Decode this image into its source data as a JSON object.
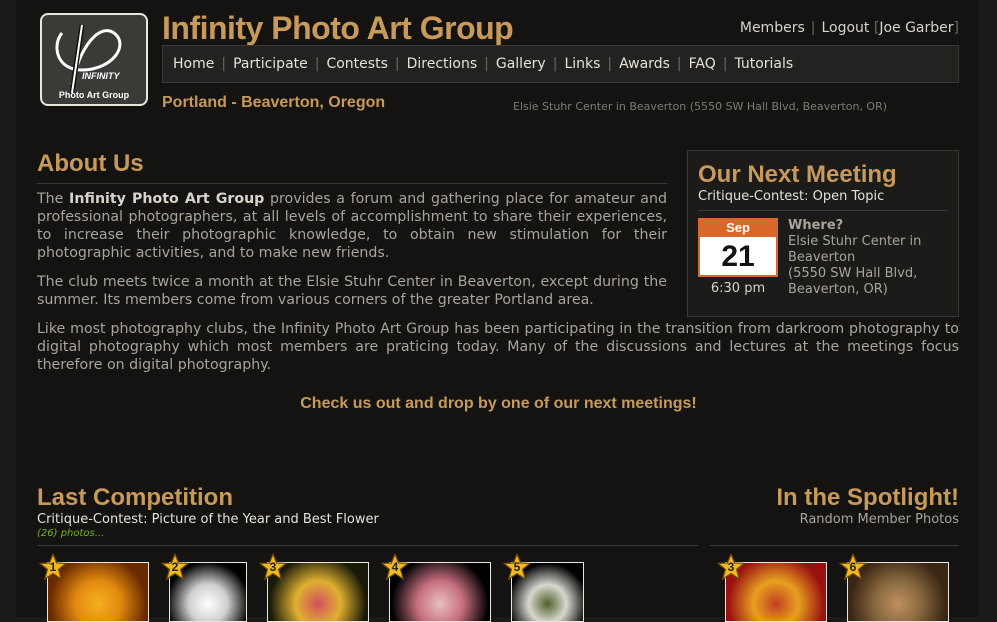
{
  "header": {
    "logo": {
      "line1": "INFINITY",
      "line2": "Photo Art Group"
    },
    "site_title": "Infinity Photo Art Group",
    "user_links": {
      "members": "Members",
      "logout": "Logout",
      "user": "Joe Garber"
    },
    "nav": [
      "Home",
      "Participate",
      "Contests",
      "Directions",
      "Gallery",
      "Links",
      "Awards",
      "FAQ",
      "Tutorials"
    ],
    "tagline": "Portland - Beaverton, Oregon",
    "location": "Elsie Stuhr Center in Beaverton (5550 SW Hall Blvd, Beaverton, OR)"
  },
  "about": {
    "title": "About Us",
    "p1_pre": "The ",
    "p1_bold": "Infinity Photo Art Group",
    "p1_post": " provides a forum and gathering place for amateur and professional photographers, at all levels of accomplishment to share their experiences, to increase their photographic knowledge, to obtain new stimulation for their photographic activities, and to make new friends.",
    "p2": "The club meets twice a month at the Elsie Stuhr Center in Beaverton, except during the summer. Its members come from various corners of the greater Portland area.",
    "p3": "Like most photography clubs, the Infinity Photo Art Group has been participating in the transition from darkroom photography to digital photography which most members are praticing today. Many of the discussions and lectures at the meetings focus therefore on digital photography.",
    "cta": "Check us out and drop by one of our next meetings!"
  },
  "meeting": {
    "title": "Our Next Meeting",
    "subtitle": "Critique-Contest: Open Topic",
    "month": "Sep",
    "day": "21",
    "time": "6:30 pm",
    "where_label": "Where?",
    "where_lines": [
      "Elsie Stuhr Center in Beaverton",
      "(5550 SW Hall Blvd,",
      "Beaverton, OR)"
    ]
  },
  "competition": {
    "title": "Last Competition",
    "subtitle": "Critique-Contest: Picture of the Year and Best Flower",
    "count": "(26) photos...",
    "thumbs": [
      {
        "rank": "1",
        "colors": [
          "#6a2a00",
          "#e38a10",
          "#f5b020"
        ]
      },
      {
        "rank": "2",
        "colors": [
          "#000000",
          "#cfcfcf",
          "#ffffff"
        ]
      },
      {
        "rank": "3",
        "colors": [
          "#1a1a0a",
          "#e0b030",
          "#d05060"
        ]
      },
      {
        "rank": "4",
        "colors": [
          "#000000",
          "#c87080",
          "#e6c0c0"
        ]
      },
      {
        "rank": "5",
        "colors": [
          "#000000",
          "#d8d8d0",
          "#50602a"
        ]
      }
    ]
  },
  "spotlight": {
    "title": "In the Spotlight!",
    "subtitle": "Random Member Photos",
    "thumbs": [
      {
        "rank": "3",
        "colors": [
          "#9a1010",
          "#e8a020",
          "#c04020"
        ]
      },
      {
        "rank": "6",
        "colors": [
          "#3a2614",
          "#8a6a40",
          "#c09060"
        ]
      }
    ]
  }
}
